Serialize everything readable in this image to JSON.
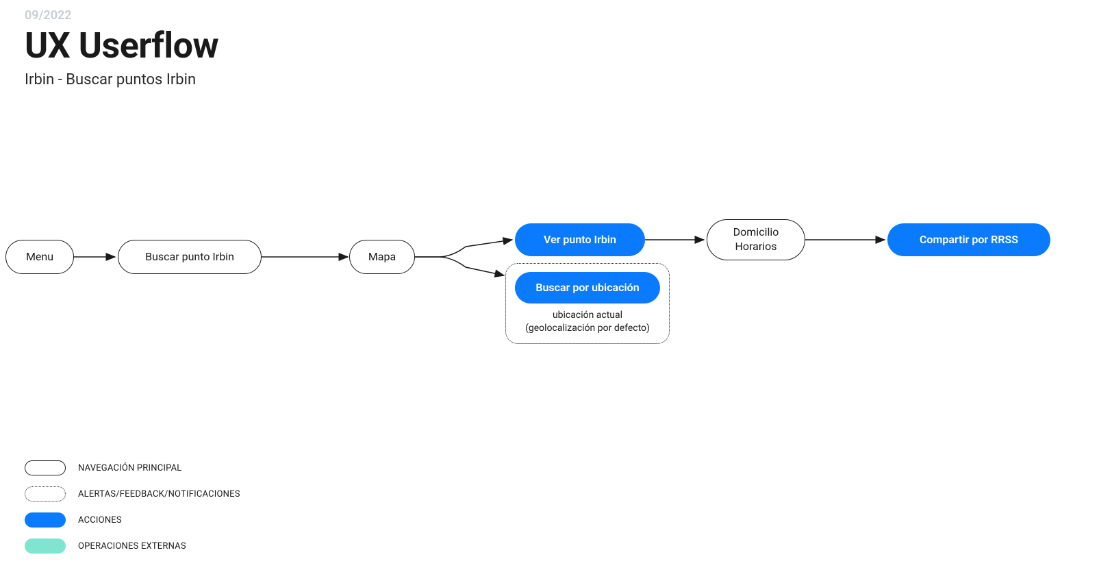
{
  "header": {
    "date": "09/2022",
    "title": "UX Userflow",
    "subtitle": "Irbin - Buscar puntos Irbin"
  },
  "nodes": {
    "menu": "Menu",
    "buscar_punto": "Buscar punto Irbin",
    "mapa": "Mapa",
    "ver_punto": "Ver punto Irbin",
    "buscar_ubicacion": "Buscar por ubicación",
    "buscar_ubicacion_caption": "ubicación actual\n(geolocalización por defecto)",
    "domicilio_line1": "Domicilio",
    "domicilio_line2": "Horarios",
    "compartir": "Compartir por RRSS"
  },
  "legend": {
    "nav": "NAVEGACIÓN PRINCIPAL",
    "feedback": "ALERTAS/FEEDBACK/NOTIFICACIONES",
    "action": "ACCIONES",
    "external": "OPERACIONES EXTERNAS"
  },
  "colors": {
    "action": "#0A7BFF",
    "external": "#7FE5D0",
    "text": "#1a1a1a",
    "muted": "#c9cdd3"
  }
}
